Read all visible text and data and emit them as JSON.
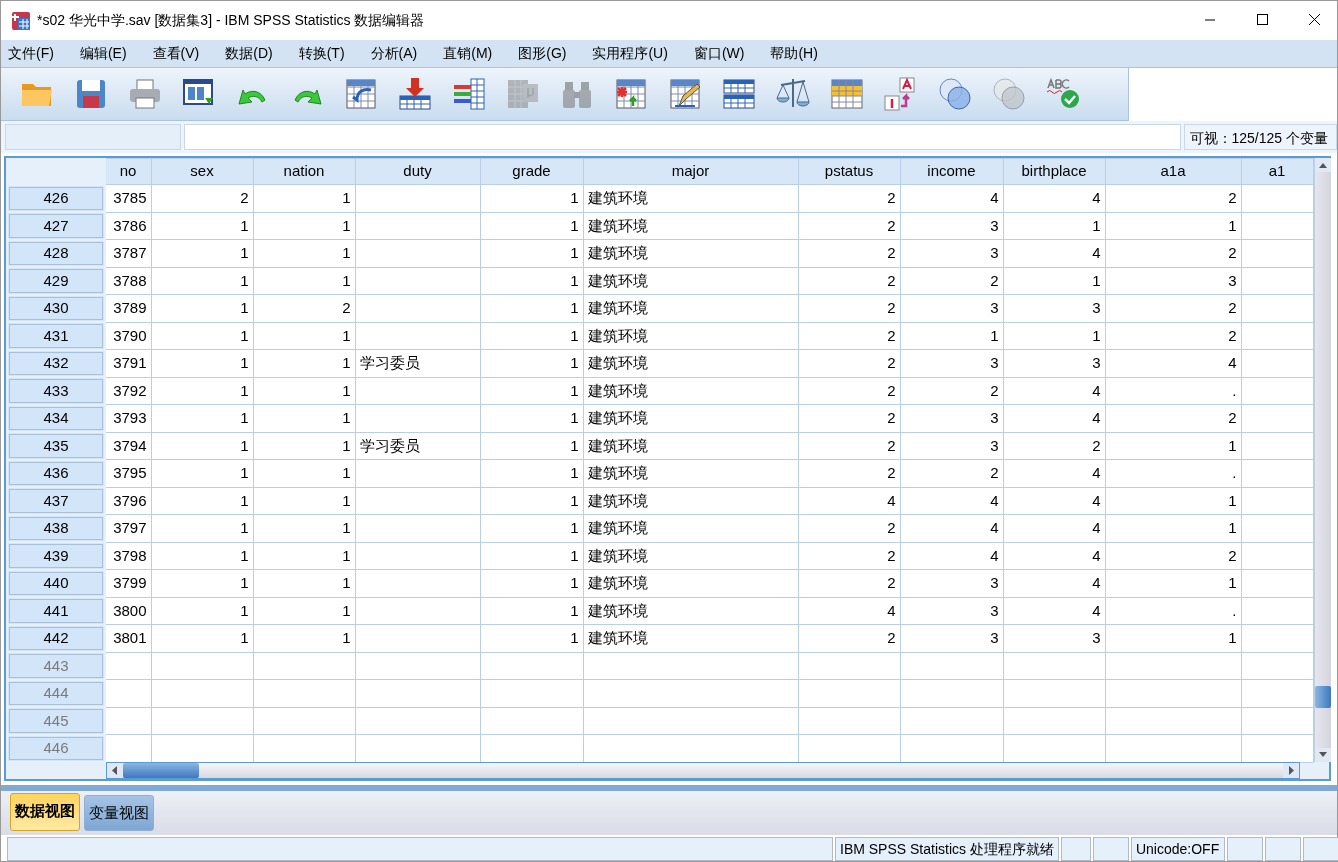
{
  "window": {
    "title": "*s02 华光中学.sav [数据集3] - IBM SPSS Statistics 数据编辑器"
  },
  "menu": [
    "文件(F)",
    "编辑(E)",
    "查看(V)",
    "数据(D)",
    "转换(T)",
    "分析(A)",
    "直销(M)",
    "图形(G)",
    "实用程序(U)",
    "窗口(W)",
    "帮助(H)"
  ],
  "toolbar": [
    {
      "kind": "folder",
      "disabled": false
    },
    {
      "kind": "floppy",
      "disabled": false
    },
    {
      "kind": "printer",
      "disabled": false
    },
    {
      "kind": "window",
      "disabled": false
    },
    {
      "kind": "undo",
      "disabled": false
    },
    {
      "kind": "redo",
      "disabled": false
    },
    {
      "kind": "tablearrow",
      "disabled": false
    },
    {
      "kind": "tabledown",
      "disabled": false
    },
    {
      "kind": "bars",
      "disabled": false
    },
    {
      "kind": "mugrid",
      "disabled": true
    },
    {
      "kind": "binoculars",
      "disabled": true
    },
    {
      "kind": "tablestar",
      "disabled": false
    },
    {
      "kind": "tablepencil",
      "disabled": false
    },
    {
      "kind": "split",
      "disabled": false
    },
    {
      "kind": "scale",
      "disabled": false
    },
    {
      "kind": "yellowgrid",
      "disabled": false
    },
    {
      "kind": "labels",
      "disabled": false
    },
    {
      "kind": "circles",
      "disabled": false
    },
    {
      "kind": "circles",
      "disabled": true
    },
    {
      "kind": "spell",
      "disabled": false
    }
  ],
  "cell_editor": {
    "visible_count": "可视：125/125 个变量"
  },
  "table": {
    "columns": [
      {
        "name": "no",
        "kind": "numeric"
      },
      {
        "name": "sex",
        "kind": "numeric"
      },
      {
        "name": "nation",
        "kind": "numeric"
      },
      {
        "name": "duty",
        "kind": "string"
      },
      {
        "name": "grade",
        "kind": "numeric"
      },
      {
        "name": "major",
        "kind": "string"
      },
      {
        "name": "pstatus",
        "kind": "numeric"
      },
      {
        "name": "income",
        "kind": "numeric"
      },
      {
        "name": "birthplace",
        "kind": "numeric"
      },
      {
        "name": "a1a",
        "kind": "numeric"
      },
      {
        "name": "a1",
        "kind": "numeric"
      }
    ],
    "rows": [
      {
        "row": "426",
        "disabled": false,
        "cells": [
          "3785",
          "2",
          "1",
          null,
          "1",
          "建筑环境",
          "2",
          "4",
          "4",
          "2",
          null
        ]
      },
      {
        "row": "427",
        "disabled": false,
        "cells": [
          "3786",
          "1",
          "1",
          null,
          "1",
          "建筑环境",
          "2",
          "3",
          "1",
          "1",
          null
        ]
      },
      {
        "row": "428",
        "disabled": false,
        "cells": [
          "3787",
          "1",
          "1",
          null,
          "1",
          "建筑环境",
          "2",
          "3",
          "4",
          "2",
          null
        ]
      },
      {
        "row": "429",
        "disabled": false,
        "cells": [
          "3788",
          "1",
          "1",
          null,
          "1",
          "建筑环境",
          "2",
          "2",
          "1",
          "3",
          null
        ]
      },
      {
        "row": "430",
        "disabled": false,
        "cells": [
          "3789",
          "1",
          "2",
          null,
          "1",
          "建筑环境",
          "2",
          "3",
          "3",
          "2",
          null
        ]
      },
      {
        "row": "431",
        "disabled": false,
        "cells": [
          "3790",
          "1",
          "1",
          null,
          "1",
          "建筑环境",
          "2",
          "1",
          "1",
          "2",
          null
        ]
      },
      {
        "row": "432",
        "disabled": false,
        "cells": [
          "3791",
          "1",
          "1",
          "学习委员",
          "1",
          "建筑环境",
          "2",
          "3",
          "3",
          "4",
          null
        ]
      },
      {
        "row": "433",
        "disabled": false,
        "cells": [
          "3792",
          "1",
          "1",
          null,
          "1",
          "建筑环境",
          "2",
          "2",
          "4",
          ".",
          null
        ]
      },
      {
        "row": "434",
        "disabled": false,
        "cells": [
          "3793",
          "1",
          "1",
          null,
          "1",
          "建筑环境",
          "2",
          "3",
          "4",
          "2",
          null
        ]
      },
      {
        "row": "435",
        "disabled": false,
        "cells": [
          "3794",
          "1",
          "1",
          "学习委员",
          "1",
          "建筑环境",
          "2",
          "3",
          "2",
          "1",
          null
        ]
      },
      {
        "row": "436",
        "disabled": false,
        "cells": [
          "3795",
          "1",
          "1",
          null,
          "1",
          "建筑环境",
          "2",
          "2",
          "4",
          ".",
          null
        ]
      },
      {
        "row": "437",
        "disabled": false,
        "cells": [
          "3796",
          "1",
          "1",
          null,
          "1",
          "建筑环境",
          "4",
          "4",
          "4",
          "1",
          null
        ]
      },
      {
        "row": "438",
        "disabled": false,
        "cells": [
          "3797",
          "1",
          "1",
          null,
          "1",
          "建筑环境",
          "2",
          "4",
          "4",
          "1",
          null
        ]
      },
      {
        "row": "439",
        "disabled": false,
        "cells": [
          "3798",
          "1",
          "1",
          null,
          "1",
          "建筑环境",
          "2",
          "4",
          "4",
          "2",
          null
        ]
      },
      {
        "row": "440",
        "disabled": false,
        "cells": [
          "3799",
          "1",
          "1",
          null,
          "1",
          "建筑环境",
          "2",
          "3",
          "4",
          "1",
          null
        ]
      },
      {
        "row": "441",
        "disabled": false,
        "cells": [
          "3800",
          "1",
          "1",
          null,
          "1",
          "建筑环境",
          "4",
          "3",
          "4",
          ".",
          null
        ]
      },
      {
        "row": "442",
        "disabled": false,
        "cells": [
          "3801",
          "1",
          "1",
          null,
          "1",
          "建筑环境",
          "2",
          "3",
          "3",
          "1",
          null
        ]
      },
      {
        "row": "443",
        "disabled": true
      },
      {
        "row": "444",
        "disabled": true
      },
      {
        "row": "445",
        "disabled": true
      },
      {
        "row": "446",
        "disabled": true
      }
    ]
  },
  "view_tabs": [
    {
      "label": "数据视图",
      "selected": true
    },
    {
      "label": "变量视图",
      "selected": false
    }
  ],
  "status_bar": [
    {
      "kind": "empty"
    },
    {
      "kind": "text",
      "text": "IBM SPSS Statistics 处理程序就绪"
    },
    {
      "kind": "empty"
    },
    {
      "kind": "empty"
    },
    {
      "kind": "text",
      "text": "Unicode:OFF"
    },
    {
      "kind": "empty"
    },
    {
      "kind": "empty"
    },
    {
      "kind": "empty"
    }
  ]
}
